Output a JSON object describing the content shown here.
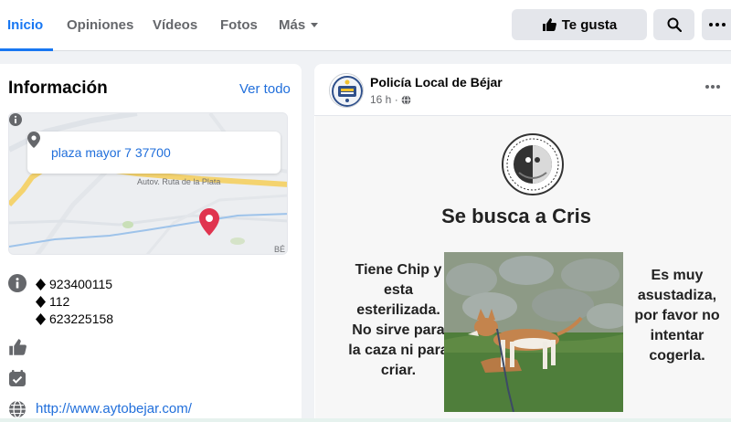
{
  "nav": {
    "tabs": [
      {
        "label": "Inicio",
        "active": true
      },
      {
        "label": "Opiniones"
      },
      {
        "label": "Vídeos"
      },
      {
        "label": "Fotos"
      },
      {
        "label": "Más"
      }
    ],
    "like_label": "Te gusta"
  },
  "info": {
    "title": "Información",
    "see_all": "Ver todo",
    "address": "plaza mayor 7 37700",
    "map_road_label": "Autov. Ruta de la Plata",
    "map_corner_label": "BÉ",
    "phones": [
      "923400115",
      "112",
      "623225158"
    ],
    "website": "http://www.aytobejar.com/"
  },
  "post": {
    "author": "Policía Local de Béjar",
    "time": "16 h",
    "headline": "Se busca a Cris",
    "left_text": "Tiene Chip y esta esterilizada. No sirve para la caza ni para criar.",
    "right_text": "Es muy asustadiza, por favor no intentar cogerla.",
    "seal_text": "BÉJAR PROTECCIÓN Y DEFENSA ANIMAL"
  },
  "colors": {
    "accent": "#1877f2",
    "link": "#216fdb",
    "map_pin": "#e0344f"
  }
}
